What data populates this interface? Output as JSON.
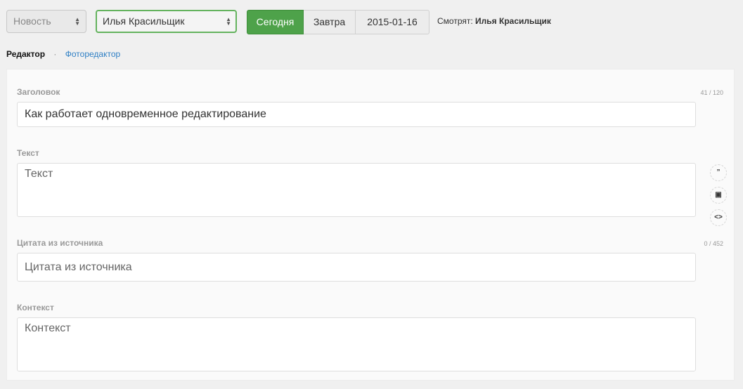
{
  "toolbar": {
    "type_select": {
      "value": "Новость",
      "icon": "select-arrows-icon"
    },
    "author_select": {
      "value": "Илья Красильщик",
      "icon": "select-arrows-icon"
    },
    "days": {
      "today_label": "Сегодня",
      "tomorrow_label": "Завтра",
      "date_label": "2015-01-16"
    },
    "watchers": {
      "label": "Смотрят:",
      "name": "Илья Красильщик"
    }
  },
  "tabs": {
    "editor": "Редактор",
    "separator": "·",
    "photo_editor": "Фоторедактор"
  },
  "form": {
    "title": {
      "label": "Заголовок",
      "counter": "41 / 120",
      "value": "Как работает одновременное редактирование"
    },
    "text": {
      "label": "Текст",
      "placeholder": "Текст"
    },
    "quote": {
      "label": "Цитата из источника",
      "counter": "0 / 452",
      "placeholder": "Цитата из источника"
    },
    "context": {
      "label": "Контекст",
      "placeholder": "Контекст"
    }
  },
  "side_tools": {
    "quote_icon": "quote-icon",
    "quote_glyph": "”",
    "embed_icon": "ticket-icon",
    "embed_glyph": "▣",
    "code_icon": "code-icon",
    "code_glyph": "<>"
  },
  "colors": {
    "accent_green": "#4ea24a",
    "link_blue": "#2e7fc4"
  }
}
